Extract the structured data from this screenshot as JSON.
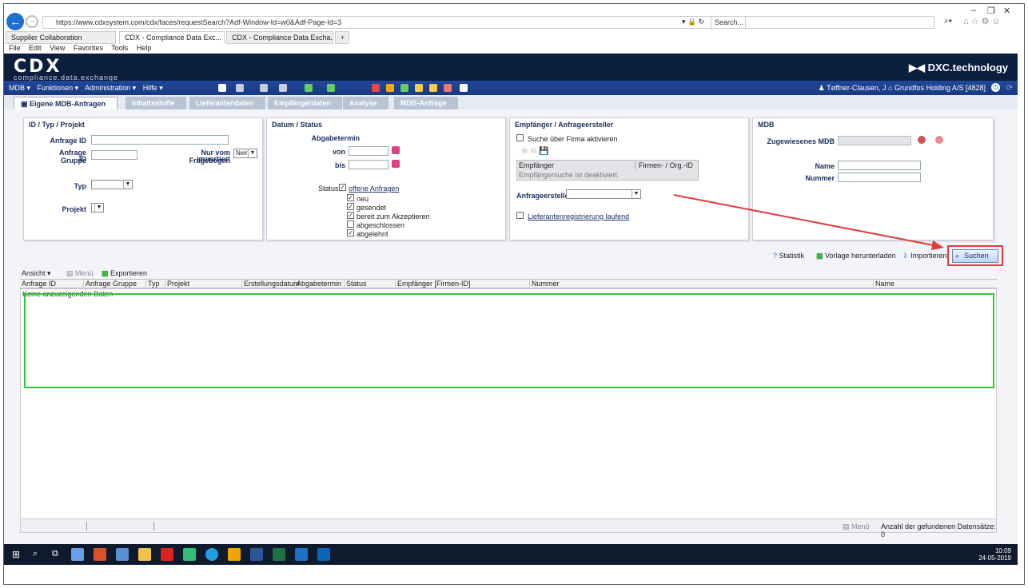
{
  "browser": {
    "url": "https://www.cdxsystem.com/cdx/faces/requestSearch?Adf-Window-Id=w0&Adf-Page-Id=3",
    "search_placeholder": "Search...",
    "tabs": [
      "Supplier Collaboration",
      "CDX - Compliance Data Exc...",
      "CDX - Compliance Data Excha..."
    ],
    "menu": [
      "File",
      "Edit",
      "View",
      "Favorites",
      "Tools",
      "Help"
    ]
  },
  "banner": {
    "logo": "CDX",
    "logo_sub": "compliance.data.exchange",
    "brand": "DXC.technology"
  },
  "appmenu": [
    "MDB ▾",
    "Funktionen ▾",
    "Administration ▾",
    "Hilfe ▾"
  ],
  "user": "Tøffner-Clausen, J",
  "company": "Grundfos Holding A/S [4828]",
  "pagetabs": [
    "Eigene MDB-Anfragen",
    "Inhaltsstoffe",
    "Lieferantendaten",
    "Empfängerdaten",
    "Analyse",
    "MDB-Anfrage"
  ],
  "panel1": {
    "title": "ID / Typ / Projekt",
    "anfrage_id": "Anfrage ID",
    "anfrage_gruppe": "Anfrage Gruppe",
    "anfrage_gruppe2": "ID",
    "nur_vom": "Nur vom Fragebogen",
    "importiert": "importiert",
    "nur_vom_value": "Nein",
    "typ": "Typ",
    "projekt": "Projekt"
  },
  "panel2": {
    "title": "Datum / Status",
    "abgabetermin": "Abgabetermin",
    "von": "von",
    "bis": "bis",
    "status": "Status",
    "offene": "offene Anfragen",
    "items": [
      "neu",
      "gesendet",
      "bereit zum Akzeptieren",
      "abgeschlossen",
      "abgelehnt"
    ]
  },
  "panel3": {
    "title": "Empfänger / Anfrageersteller",
    "suche": "Suche über Firma aktivieren",
    "col1": "Empfänger",
    "col2": "Firmen- / Org.-ID",
    "disabled": "Empfängersuche ist deaktiviert.",
    "anfrageersteller": "Anfrageersteller",
    "lieferanten": "Lieferantenregistrierung laufend"
  },
  "panel4": {
    "title": "MDB",
    "zugewiesenes": "Zugewiesenes MDB",
    "name": "Name",
    "nummer": "Nummer"
  },
  "actions": {
    "statistik": "Statistik",
    "vorlage": "Vorlage herunterladen",
    "importieren": "Importieren",
    "suchen": "Suchen"
  },
  "grid": {
    "ansicht": "Ansicht ▾",
    "menu": "Menü",
    "exportieren": "Exportieren",
    "headers": [
      "Anfrage ID",
      "Anfrage Gruppe ID",
      "Typ",
      "Projekt",
      "Erstellungsdatum",
      "Abgabetermin",
      "Status",
      "Empfänger [Firmen-ID]",
      "Nummer",
      "Name"
    ],
    "empty": "Keine anzuzeigenden Daten",
    "footer_menu": "Menü",
    "count": "Anzahl der gefundenen Datensätze: 0"
  },
  "taskbar": {
    "time": "10:09",
    "date": "24-05-2019"
  },
  "colors": {
    "highlight_green": "#34c534",
    "highlight_red": "#e23a3a",
    "brand_navy": "#0b1e3e"
  }
}
